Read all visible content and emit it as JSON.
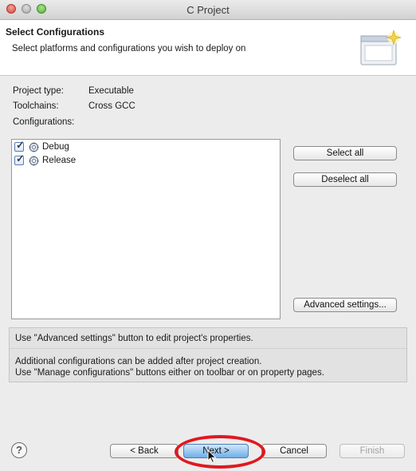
{
  "window": {
    "title": "C Project"
  },
  "header": {
    "title": "Select Configurations",
    "description": "Select platforms and configurations you wish to deploy on"
  },
  "info": {
    "project_type_label": "Project type:",
    "project_type_value": "Executable",
    "toolchains_label": "Toolchains:",
    "toolchains_value": "Cross GCC",
    "configurations_label": "Configurations:"
  },
  "configurations": [
    {
      "label": "Debug",
      "checked": true
    },
    {
      "label": "Release",
      "checked": true
    }
  ],
  "side_buttons": {
    "select_all": "Select all",
    "deselect_all": "Deselect all",
    "advanced": "Advanced settings..."
  },
  "messages": {
    "line1": "Use \"Advanced settings\" button to edit project's properties.",
    "line2": "Additional configurations can be added after project creation.",
    "line3": "Use \"Manage configurations\" buttons either on toolbar or on property pages."
  },
  "footer": {
    "help": "?",
    "back": "< Back",
    "next": "Next >",
    "cancel": "Cancel",
    "finish": "Finish"
  },
  "colors": {
    "accent": "#6eaee8",
    "annotation": "#e0181f"
  }
}
